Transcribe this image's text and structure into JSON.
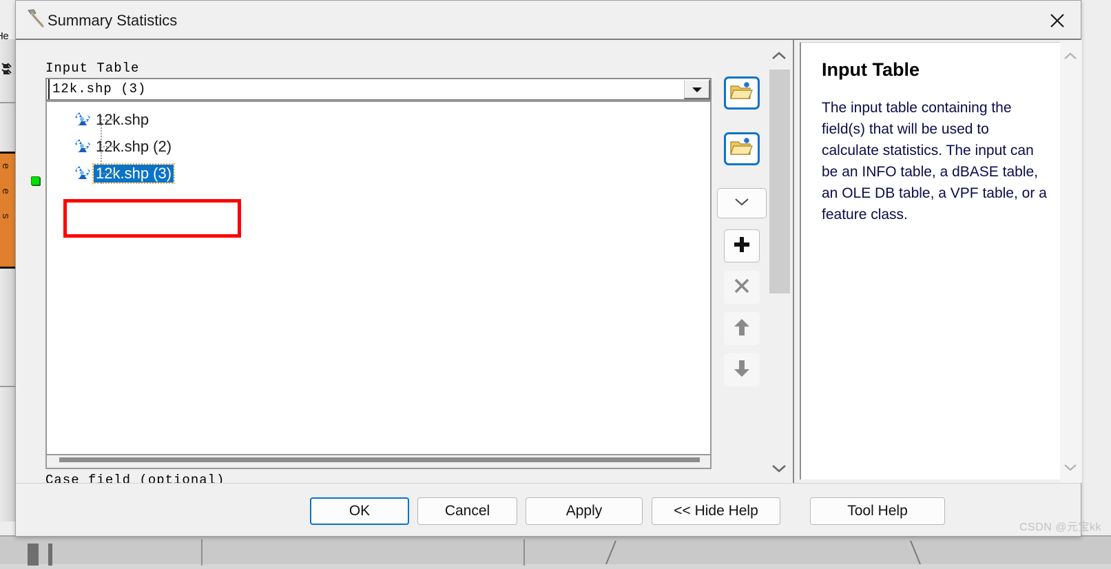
{
  "window": {
    "title": "Summary Statistics",
    "title_icon": "hammer-tool-icon",
    "close_icon": "close-icon"
  },
  "background_app": {
    "menu_label": "He",
    "vertical_tab_label": "e e s",
    "pin_icons": [
      "pin-arrow-icon",
      "pin-arrow-icon"
    ]
  },
  "parameters": {
    "input_table": {
      "label": "Input Table",
      "value": "12k.shp (3)",
      "required_indicator": "green-dot",
      "dropdown_arrow_icon": "triangle-down-icon",
      "options": [
        {
          "label": "12k.shp",
          "icon": "feature-layer-icon",
          "selected": false
        },
        {
          "label": "12k.shp (2)",
          "icon": "feature-layer-icon",
          "selected": false
        },
        {
          "label": "12k.shp (3)",
          "icon": "feature-layer-icon",
          "selected": true
        }
      ]
    },
    "case_field": {
      "label": "Case field (optional)",
      "value": ""
    }
  },
  "tool_column": {
    "buttons": [
      {
        "name": "browse-input-table",
        "icon": "folder-open-add-icon",
        "focused": true
      },
      {
        "name": "browse-output-table",
        "icon": "folder-open-add-icon",
        "focused": true
      },
      {
        "name": "field-dropdown",
        "icon": "chevron-down-icon",
        "focused": false
      },
      {
        "name": "add-row",
        "icon": "plus-icon",
        "focused": false
      },
      {
        "name": "remove-row",
        "icon": "x-icon",
        "focused": false
      },
      {
        "name": "move-up",
        "icon": "arrow-up-icon",
        "focused": false
      },
      {
        "name": "move-down",
        "icon": "arrow-down-icon",
        "focused": false
      }
    ]
  },
  "help": {
    "title": "Input Table",
    "body": "The input table containing the field(s) that will be used to calculate statistics. The input can be an INFO table, a dBASE table, an OLE DB table, a VPF table, or a feature class.",
    "scroll_up_icon": "chevron-up-icon",
    "scroll_down_icon": "chevron-down-icon"
  },
  "buttons": {
    "ok": "OK",
    "cancel": "Cancel",
    "apply": "Apply",
    "hide_help": "<< Hide Help",
    "tool_help": "Tool Help"
  },
  "scrollbar": {
    "up_icon": "chevron-up-icon",
    "down_icon": "chevron-down-icon"
  },
  "watermark": "CSDN @元宝kk",
  "colors": {
    "accent_blue": "#0a74c8",
    "selection_blue": "#0a74c8",
    "annotation_red": "#ff0000",
    "required_green": "#00e000",
    "orange_tab": "#e0802c",
    "help_text": "#0b0b4a",
    "dialog_bg": "#f0f0f0"
  }
}
